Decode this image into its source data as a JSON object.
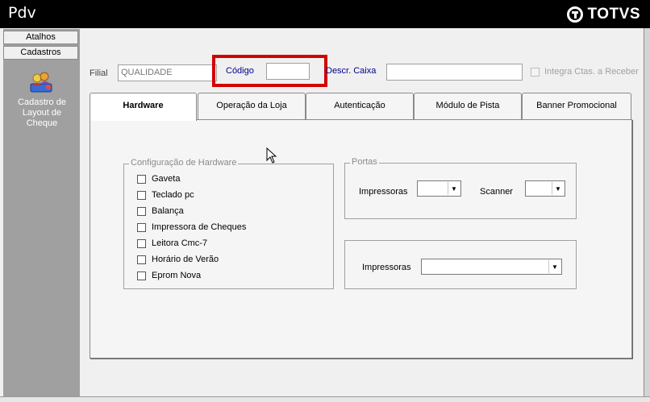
{
  "app": {
    "title": "Pdv",
    "brand": "TOTVS"
  },
  "sidebar": {
    "buttons": [
      {
        "label": "Atalhos"
      },
      {
        "label": "Cadastros"
      }
    ],
    "item": {
      "label_lines": [
        "Cadastro de",
        "Layout de",
        "Cheque"
      ]
    }
  },
  "header": {
    "filial_label": "Filial",
    "filial_value": "QUALIDADE",
    "codigo_label": "Código",
    "codigo_value": "",
    "descr_label": "Descr. Caixa",
    "descr_value": "",
    "integra_label": "Integra Ctas. a Receber",
    "integra_checked": false
  },
  "tabs": [
    {
      "label": "Hardware",
      "active": true
    },
    {
      "label": "Operação da Loja"
    },
    {
      "label": "Autenticação"
    },
    {
      "label": "Módulo de Pista"
    },
    {
      "label": "Banner Promocional"
    }
  ],
  "hardware": {
    "group_title": "Configuração de Hardware",
    "options": [
      {
        "label": "Gaveta",
        "checked": false
      },
      {
        "label": "Teclado pc",
        "checked": false
      },
      {
        "label": "Balança",
        "checked": false
      },
      {
        "label": "Impressora de Cheques",
        "checked": false
      },
      {
        "label": "Leitora Cmc-7",
        "checked": false
      },
      {
        "label": "Horário de Verão",
        "checked": false
      },
      {
        "label": "Eprom Nova",
        "checked": false
      }
    ]
  },
  "portas": {
    "group_title": "Portas",
    "impressoras_label": "Impressoras",
    "impressoras_value": "",
    "scanner_label": "Scanner",
    "scanner_value": ""
  },
  "impressoras2": {
    "label": "Impressoras",
    "value": ""
  },
  "colors": {
    "highlight": "#d40000",
    "titlebar": "#000000",
    "sidebar": "#a0a0a0",
    "label_blue": "#00008b"
  }
}
